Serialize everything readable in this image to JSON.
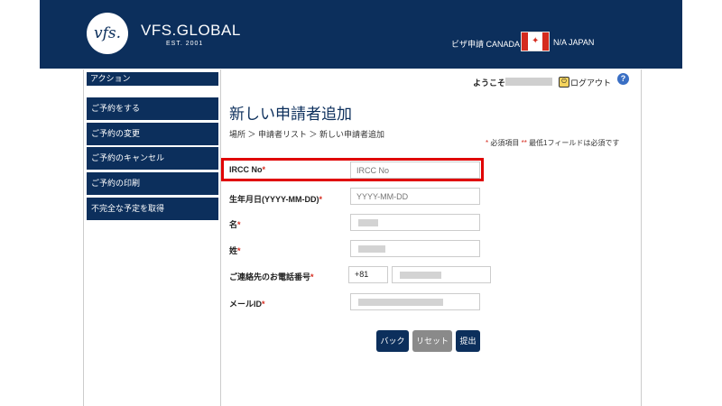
{
  "header": {
    "logo_mark": "vfs.",
    "logo_name": "VFS.GLOBAL",
    "logo_est": "EST. 2001",
    "left_label": "ビザ申請 CANADA",
    "flag_leaf": "✦",
    "right_label": "N/A JAPAN"
  },
  "sidebar": {
    "title": "アクション",
    "items": [
      {
        "label": "ご予約をする"
      },
      {
        "label": "ご予約の変更"
      },
      {
        "label": "ご予約のキャンセル"
      },
      {
        "label": "ご予約の印刷"
      },
      {
        "label": "不完全な予定を取得"
      }
    ]
  },
  "topbar": {
    "welcome": "ようこそ",
    "logout": "ログアウト",
    "help": "?"
  },
  "page": {
    "title": "新しい申請者追加",
    "breadcrumb": "場所 ＞ 申請者リスト ＞ 新しい申請者追加",
    "required_star": "*",
    "required_text": "必須項目",
    "required_star2": "**",
    "required_text2": "最低1フィールドは必須です"
  },
  "form": {
    "ircc_label": "IRCC No",
    "ircc_placeholder": "IRCC No",
    "dob_label": "生年月日(YYYY-MM-DD)",
    "dob_placeholder": "YYYY-MM-DD",
    "first_name_label": "名",
    "last_name_label": "姓",
    "phone_label": "ご連絡先のお電話番号",
    "phone_code": "+81",
    "email_label": "メールID",
    "required_mark": "*"
  },
  "buttons": {
    "back": "バック",
    "reset": "リセット",
    "submit": "提出"
  },
  "colors": {
    "brand_navy": "#0c2f5c",
    "highlight_red": "#e00000",
    "reset_gray": "#8a8a8a"
  }
}
